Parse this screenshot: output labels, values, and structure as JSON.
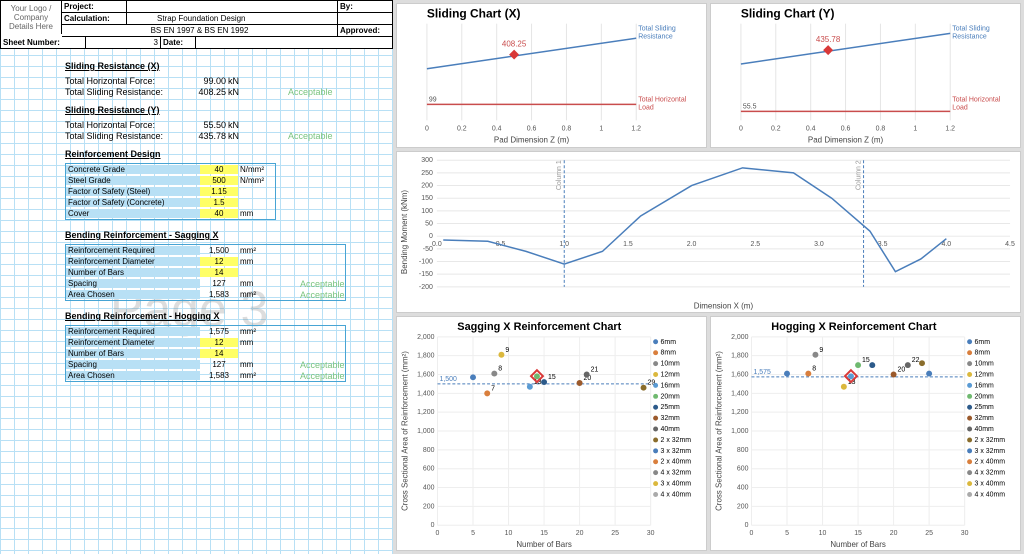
{
  "header": {
    "logo": "Your Logo / Company Details Here",
    "project_lbl": "Project:",
    "project": "",
    "by_lbl": "By:",
    "by": "",
    "calc_lbl": "Calculation:",
    "calc": "Strap Foundation Design",
    "standard": "BS EN 1997 & BS EN 1992",
    "approved_lbl": "Approved:",
    "approved": "",
    "sheet_lbl": "Sheet Number:",
    "sheet": "3",
    "date_lbl": "Date:",
    "date": ""
  },
  "watermark": "Page 3",
  "srx": {
    "title": "Sliding Resistance (X)",
    "thf_lbl": "Total Horizontal Force:",
    "thf": "99.00",
    "thf_u": "kN",
    "tsr_lbl": "Total Sliding Resistance:",
    "tsr": "408.25",
    "tsr_u": "kN",
    "status": "Acceptable"
  },
  "sry": {
    "title": "Sliding Resistance (Y)",
    "thf_lbl": "Total Horizontal Force:",
    "thf": "55.50",
    "thf_u": "kN",
    "tsr_lbl": "Total Sliding Resistance:",
    "tsr": "435.78",
    "tsr_u": "kN",
    "status": "Acceptable"
  },
  "rd": {
    "title": "Reinforcement Design",
    "rows": [
      {
        "lbl": "Concrete Grade",
        "val": "40",
        "unit": "N/mm²",
        "input": true
      },
      {
        "lbl": "Steel Grade",
        "val": "500",
        "unit": "N/mm²",
        "input": true
      },
      {
        "lbl": "Factor of Safety (Steel)",
        "val": "1.15",
        "unit": "",
        "input": true
      },
      {
        "lbl": "Factor of Safety (Concrete)",
        "val": "1.5",
        "unit": "",
        "input": true
      },
      {
        "lbl": "Cover",
        "val": "40",
        "unit": "mm",
        "input": true
      }
    ]
  },
  "bsx": {
    "title": "Bending Reinforcement - Sagging X",
    "rows": [
      {
        "lbl": "Reinforcement Required",
        "val": "1,500",
        "unit": "mm²",
        "input": false
      },
      {
        "lbl": "Reinforcement Diameter",
        "val": "12",
        "unit": "mm",
        "input": true
      },
      {
        "lbl": "Number of Bars",
        "val": "14",
        "unit": "",
        "input": true
      },
      {
        "lbl": "Spacing",
        "val": "127",
        "unit": "mm",
        "input": false,
        "status": "Acceptable"
      },
      {
        "lbl": "Area Chosen",
        "val": "1,583",
        "unit": "mm²",
        "input": false,
        "status": "Acceptable"
      }
    ]
  },
  "bhx": {
    "title": "Bending Reinforcement - Hogging X",
    "rows": [
      {
        "lbl": "Reinforcement Required",
        "val": "1,575",
        "unit": "mm²",
        "input": false
      },
      {
        "lbl": "Reinforcement Diameter",
        "val": "12",
        "unit": "mm",
        "input": true
      },
      {
        "lbl": "Number of Bars",
        "val": "14",
        "unit": "",
        "input": true
      },
      {
        "lbl": "Spacing",
        "val": "127",
        "unit": "mm",
        "input": false,
        "status": "Acceptable"
      },
      {
        "lbl": "Area Chosen",
        "val": "1,583",
        "unit": "mm²",
        "input": false,
        "status": "Acceptable"
      }
    ]
  },
  "chart_data": [
    {
      "id": "sliding_x",
      "type": "line",
      "title": "Sliding Chart (X)",
      "xlabel": "Pad Dimension Z (m)",
      "xlim": [
        0,
        1.2
      ],
      "xticks": [
        0,
        0.2,
        0.4,
        0.6,
        0.8,
        1.0,
        1.2
      ],
      "series": [
        {
          "name": "Total Sliding Resistance",
          "color": "#4a7ebb",
          "x": [
            0,
            1.2
          ],
          "y": [
            320,
            510
          ]
        },
        {
          "name": "Total Horizontal Load",
          "color": "#c94d4d",
          "x": [
            0,
            1.2
          ],
          "y": [
            99,
            99
          ]
        }
      ],
      "marker": {
        "x": 0.5,
        "y": 408.25,
        "label": "408.25"
      },
      "hlabel": "99"
    },
    {
      "id": "sliding_y",
      "type": "line",
      "title": "Sliding Chart (Y)",
      "xlabel": "Pad Dimension Z (m)",
      "xlim": [
        0,
        1.2
      ],
      "xticks": [
        0,
        0.2,
        0.4,
        0.6,
        0.8,
        1.0,
        1.2
      ],
      "series": [
        {
          "name": "Total Sliding Resistance",
          "color": "#4a7ebb",
          "x": [
            0,
            1.2
          ],
          "y": [
            350,
            540
          ]
        },
        {
          "name": "Total Horizontal Load",
          "color": "#c94d4d",
          "x": [
            0,
            1.2
          ],
          "y": [
            55.5,
            55.5
          ]
        }
      ],
      "marker": {
        "x": 0.5,
        "y": 435.78,
        "label": "435.78"
      },
      "hlabel": "55.5"
    },
    {
      "id": "bending",
      "type": "line",
      "title": "",
      "xlabel": "Dimension X (m)",
      "ylabel": "Bending Moment (kNm)",
      "xlim": [
        0,
        4.5
      ],
      "ylim": [
        -200,
        300
      ],
      "xticks": [
        0.0,
        0.5,
        1.0,
        1.5,
        2.0,
        2.5,
        3.0,
        3.5,
        4.0,
        4.5
      ],
      "yticks": [
        -200,
        -150,
        -100,
        -50,
        0,
        50,
        100,
        150,
        200,
        250,
        300
      ],
      "series": [
        {
          "name": "Moment",
          "color": "#4a7ebb",
          "x": [
            0.05,
            0.4,
            0.7,
            1.0,
            1.3,
            1.6,
            2.0,
            2.4,
            2.8,
            3.1,
            3.4,
            3.6,
            3.8,
            4.0
          ],
          "y": [
            -15,
            -20,
            -60,
            -110,
            -60,
            80,
            200,
            270,
            250,
            150,
            20,
            -140,
            -90,
            -10
          ]
        }
      ],
      "vlines": [
        1.0,
        3.35
      ],
      "vlabels": [
        "Column 1",
        "Column 2"
      ]
    },
    {
      "id": "sagging",
      "type": "scatter",
      "title": "Sagging X Reinforcement Chart",
      "xlabel": "Number of Bars",
      "ylabel": "Cross Sectional Area of Reinforcement (mm²)",
      "xlim": [
        0,
        30
      ],
      "ylim": [
        0,
        2000
      ],
      "xticks": [
        0,
        5,
        10,
        15,
        20,
        25,
        30
      ],
      "yticks": [
        0,
        200,
        400,
        600,
        800,
        1000,
        1200,
        1400,
        1600,
        1800,
        2000
      ],
      "hline": {
        "y": 1500,
        "label": "1,500",
        "name": "Area Required"
      },
      "marker": {
        "x": 14,
        "y": 1583
      },
      "legend": [
        "6mm",
        "8mm",
        "10mm",
        "12mm",
        "16mm",
        "20mm",
        "25mm",
        "32mm",
        "40mm",
        "2 x 32mm",
        "3 x 32mm",
        "2 x 40mm",
        "4 x 32mm",
        "3 x 40mm",
        "4 x 40mm"
      ],
      "points": [
        {
          "x": 5,
          "y": 1570
        },
        {
          "x": 7,
          "y": 1400,
          "lbl": "7"
        },
        {
          "x": 8,
          "y": 1610,
          "lbl": "8"
        },
        {
          "x": 9,
          "y": 1810,
          "lbl": "9"
        },
        {
          "x": 13,
          "y": 1470,
          "lbl": "13"
        },
        {
          "x": 14,
          "y": 1580
        },
        {
          "x": 15,
          "y": 1520,
          "lbl": "15"
        },
        {
          "x": 20,
          "y": 1510,
          "lbl": "20"
        },
        {
          "x": 21,
          "y": 1600,
          "lbl": "21"
        },
        {
          "x": 29,
          "y": 1460,
          "lbl": "29"
        }
      ]
    },
    {
      "id": "hogging",
      "type": "scatter",
      "title": "Hogging X Reinforcement Chart",
      "xlabel": "Number of Bars",
      "ylabel": "Cross Sectional Area of Reinforcement (mm²)",
      "xlim": [
        0,
        30
      ],
      "ylim": [
        0,
        2000
      ],
      "xticks": [
        0,
        5,
        10,
        15,
        20,
        25,
        30
      ],
      "yticks": [
        0,
        200,
        400,
        600,
        800,
        1000,
        1200,
        1400,
        1600,
        1800,
        2000
      ],
      "hline": {
        "y": 1575,
        "label": "1,575",
        "name": "Area Required"
      },
      "marker": {
        "x": 14,
        "y": 1583
      },
      "legend": [
        "6mm",
        "8mm",
        "10mm",
        "12mm",
        "16mm",
        "20mm",
        "25mm",
        "32mm",
        "40mm",
        "2 x 32mm",
        "3 x 32mm",
        "2 x 40mm",
        "4 x 32mm",
        "3 x 40mm",
        "4 x 40mm"
      ],
      "points": [
        {
          "x": 5,
          "y": 1610
        },
        {
          "x": 8,
          "y": 1610,
          "lbl": "8"
        },
        {
          "x": 9,
          "y": 1810,
          "lbl": "9"
        },
        {
          "x": 13,
          "y": 1470,
          "lbl": "13"
        },
        {
          "x": 14,
          "y": 1580
        },
        {
          "x": 15,
          "y": 1700,
          "lbl": "15"
        },
        {
          "x": 17,
          "y": 1700
        },
        {
          "x": 20,
          "y": 1600,
          "lbl": "20"
        },
        {
          "x": 22,
          "y": 1700,
          "lbl": "22"
        },
        {
          "x": 24,
          "y": 1720
        },
        {
          "x": 25,
          "y": 1610
        }
      ]
    }
  ]
}
